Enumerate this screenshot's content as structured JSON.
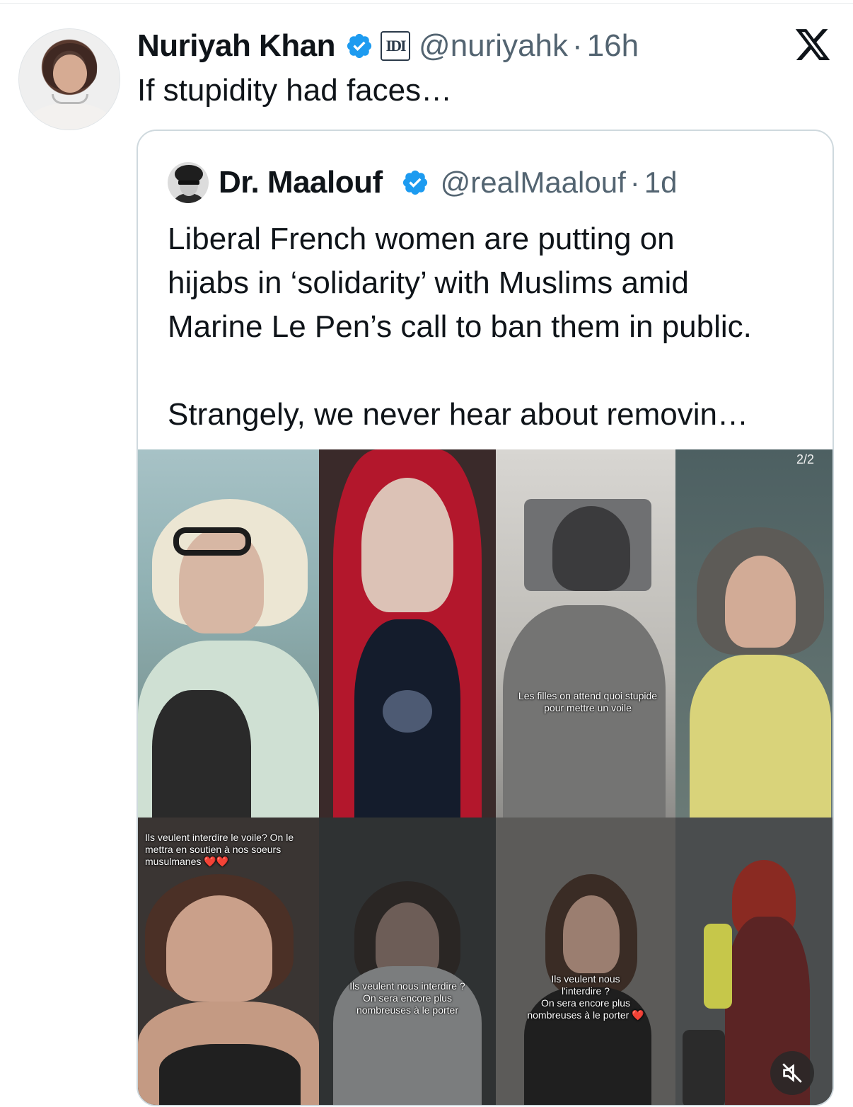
{
  "author": {
    "name": "Nuriyah Khan",
    "org_badge": "IDI",
    "handle": "@nuriyahk",
    "separator": "·",
    "time": "16h",
    "text": "If stupidity had faces…"
  },
  "quoted": {
    "name": "Dr. Maalouf",
    "handle": "@realMaalouf",
    "separator": "·",
    "time": "1d",
    "text": "Liberal French women are putting on\nhijabs in ‘solidarity’ with Muslims amid\nMarine Le Pen’s call to ban them in public.\n\nStrangely, we never hear about removin…"
  },
  "media": {
    "counter": "2/2",
    "captions": {
      "tile3": "Les filles on attend quoi stupide pour mettre un voile",
      "tile5": "Ils veulent interdire le voile? On le mettra en soutien à nos soeurs musulmanes ❤️❤️",
      "tile6": "Ils veulent nous interdire ?\nOn sera encore plus\nnombreuses à le porter",
      "tile7": "Ils veulent nous\nl'interdire ?\nOn sera encore plus\nnombreuses à le porter ❤️"
    }
  },
  "colors": {
    "verified": "#1d9bf0",
    "muted_text": "#536471",
    "border": "#cfd9de"
  },
  "icons": {
    "verified": "verified-badge-icon",
    "close": "x-logo-icon",
    "mute": "muted-speaker-icon"
  }
}
